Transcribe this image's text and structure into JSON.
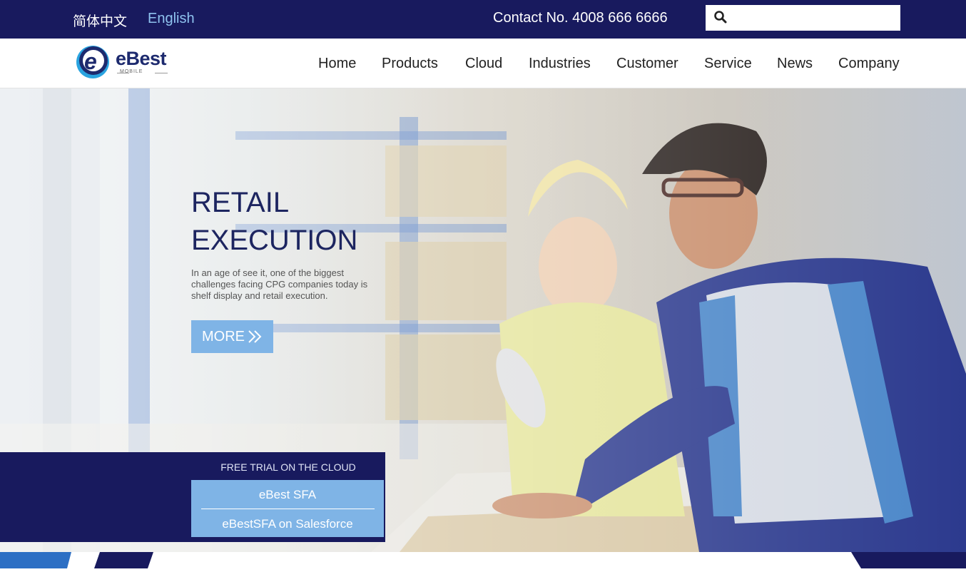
{
  "topbar": {
    "lang_zh": "简体中文",
    "lang_en": "English",
    "contact": "Contact No. 4008 666 6666",
    "search_placeholder": ""
  },
  "logo": {
    "name": "eBest",
    "sub": "MOBILE"
  },
  "nav": [
    "Home",
    "Products",
    "Cloud",
    "Industries",
    "Customer",
    "Service",
    "News",
    "Company"
  ],
  "hero": {
    "title_line1": "RETAIL",
    "title_line2": "EXECUTION",
    "description": "In an age of see it, one of the biggest challenges facing CPG companies today is shelf display and retail execution.",
    "more_label": "MORE"
  },
  "trial": {
    "title": "FREE TRIAL ON THE CLOUD",
    "link1": "eBest SFA",
    "link2": "eBestSFA on Salesforce"
  },
  "colors": {
    "navy": "#181a5e",
    "accent_blue": "#7fb4e6",
    "heading": "#1d2560"
  }
}
